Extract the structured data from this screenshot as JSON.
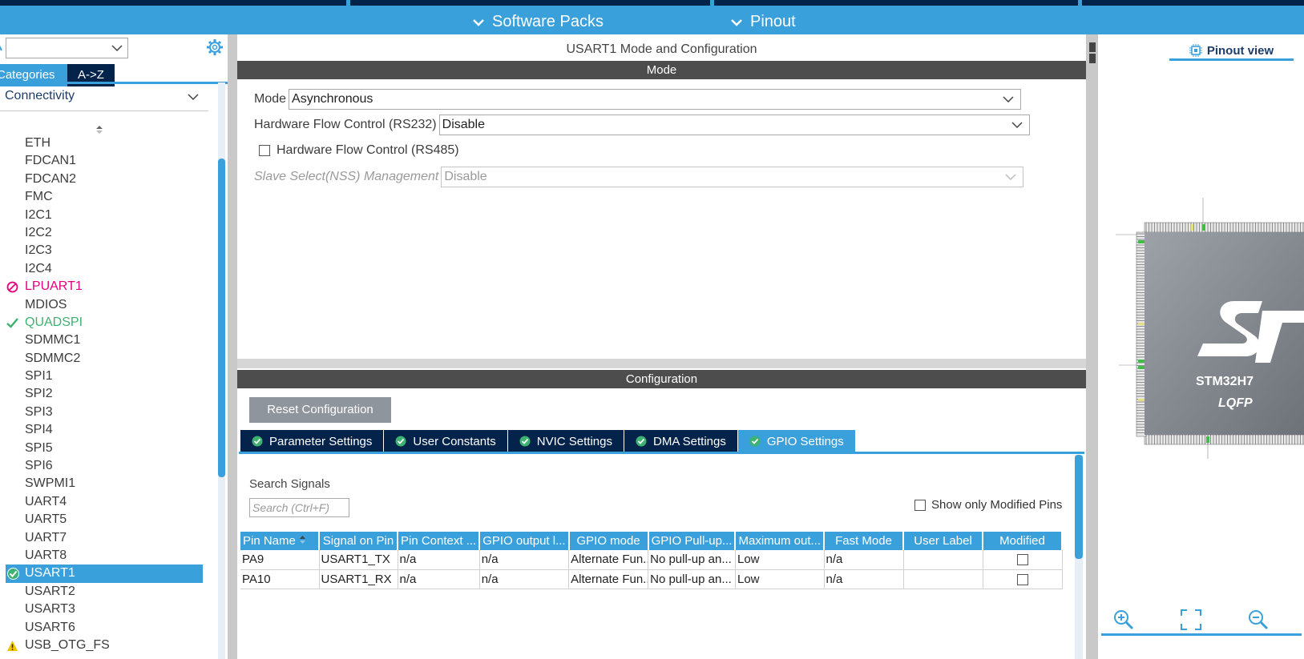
{
  "topbar": {
    "menus": [
      "Software Packs",
      "Pinout"
    ]
  },
  "left_panel": {
    "tabs": [
      "Categories",
      "A->Z"
    ],
    "category": "Connectivity",
    "peripherals": [
      {
        "name": "ETH",
        "status": "none"
      },
      {
        "name": "FDCAN1",
        "status": "none"
      },
      {
        "name": "FDCAN2",
        "status": "none"
      },
      {
        "name": "FMC",
        "status": "none"
      },
      {
        "name": "I2C1",
        "status": "none"
      },
      {
        "name": "I2C2",
        "status": "none"
      },
      {
        "name": "I2C3",
        "status": "none"
      },
      {
        "name": "I2C4",
        "status": "none"
      },
      {
        "name": "LPUART1",
        "status": "conflict"
      },
      {
        "name": "MDIOS",
        "status": "none"
      },
      {
        "name": "QUADSPI",
        "status": "ok"
      },
      {
        "name": "SDMMC1",
        "status": "none"
      },
      {
        "name": "SDMMC2",
        "status": "none"
      },
      {
        "name": "SPI1",
        "status": "none"
      },
      {
        "name": "SPI2",
        "status": "none"
      },
      {
        "name": "SPI3",
        "status": "none"
      },
      {
        "name": "SPI4",
        "status": "none"
      },
      {
        "name": "SPI5",
        "status": "none"
      },
      {
        "name": "SPI6",
        "status": "none"
      },
      {
        "name": "SWPMI1",
        "status": "none"
      },
      {
        "name": "UART4",
        "status": "none"
      },
      {
        "name": "UART5",
        "status": "none"
      },
      {
        "name": "UART7",
        "status": "none"
      },
      {
        "name": "UART8",
        "status": "none"
      },
      {
        "name": "USART1",
        "status": "selected"
      },
      {
        "name": "USART2",
        "status": "none"
      },
      {
        "name": "USART3",
        "status": "none"
      },
      {
        "name": "USART6",
        "status": "none"
      },
      {
        "name": "USB_OTG_FS",
        "status": "warning"
      }
    ]
  },
  "main": {
    "title": "USART1 Mode and Configuration",
    "mode_header": "Mode",
    "mode": {
      "mode_label": "Mode",
      "mode_value": "Asynchronous",
      "hwflow232_label": "Hardware Flow Control (RS232)",
      "hwflow232_value": "Disable",
      "hwflow485_label": "Hardware Flow Control (RS485)",
      "nss_label": "Slave Select(NSS) Management",
      "nss_value": "Disable"
    },
    "config_header": "Configuration",
    "reset_label": "Reset Configuration",
    "tabs": [
      "Parameter Settings",
      "User Constants",
      "NVIC Settings",
      "DMA Settings",
      "GPIO Settings"
    ],
    "active_tab": "GPIO Settings",
    "search_label": "Search Signals",
    "search_placeholder": "Search (Ctrl+F)",
    "show_modified_label": "Show only Modified Pins",
    "table": {
      "columns": [
        "Pin Name",
        "Signal on Pin",
        "Pin Context ...",
        "GPIO output l...",
        "GPIO mode",
        "GPIO Pull-up...",
        "Maximum out...",
        "Fast Mode",
        "User Label",
        "Modified"
      ],
      "rows": [
        [
          "PA9",
          "USART1_TX",
          "n/a",
          "n/a",
          "Alternate Fun...",
          "No pull-up an...",
          "Low",
          "n/a",
          "",
          ""
        ],
        [
          "PA10",
          "USART1_RX",
          "n/a",
          "n/a",
          "Alternate Fun...",
          "No pull-up an...",
          "Low",
          "n/a",
          "",
          ""
        ]
      ]
    }
  },
  "right_panel": {
    "tab": "Pinout view",
    "chip_name": "STM32H7",
    "package": "LQFP"
  },
  "colors": {
    "accent": "#3aa0db",
    "navy": "#03234b",
    "ok": "#3cb371",
    "conflict": "#e6007e",
    "warning": "#f2c200"
  }
}
